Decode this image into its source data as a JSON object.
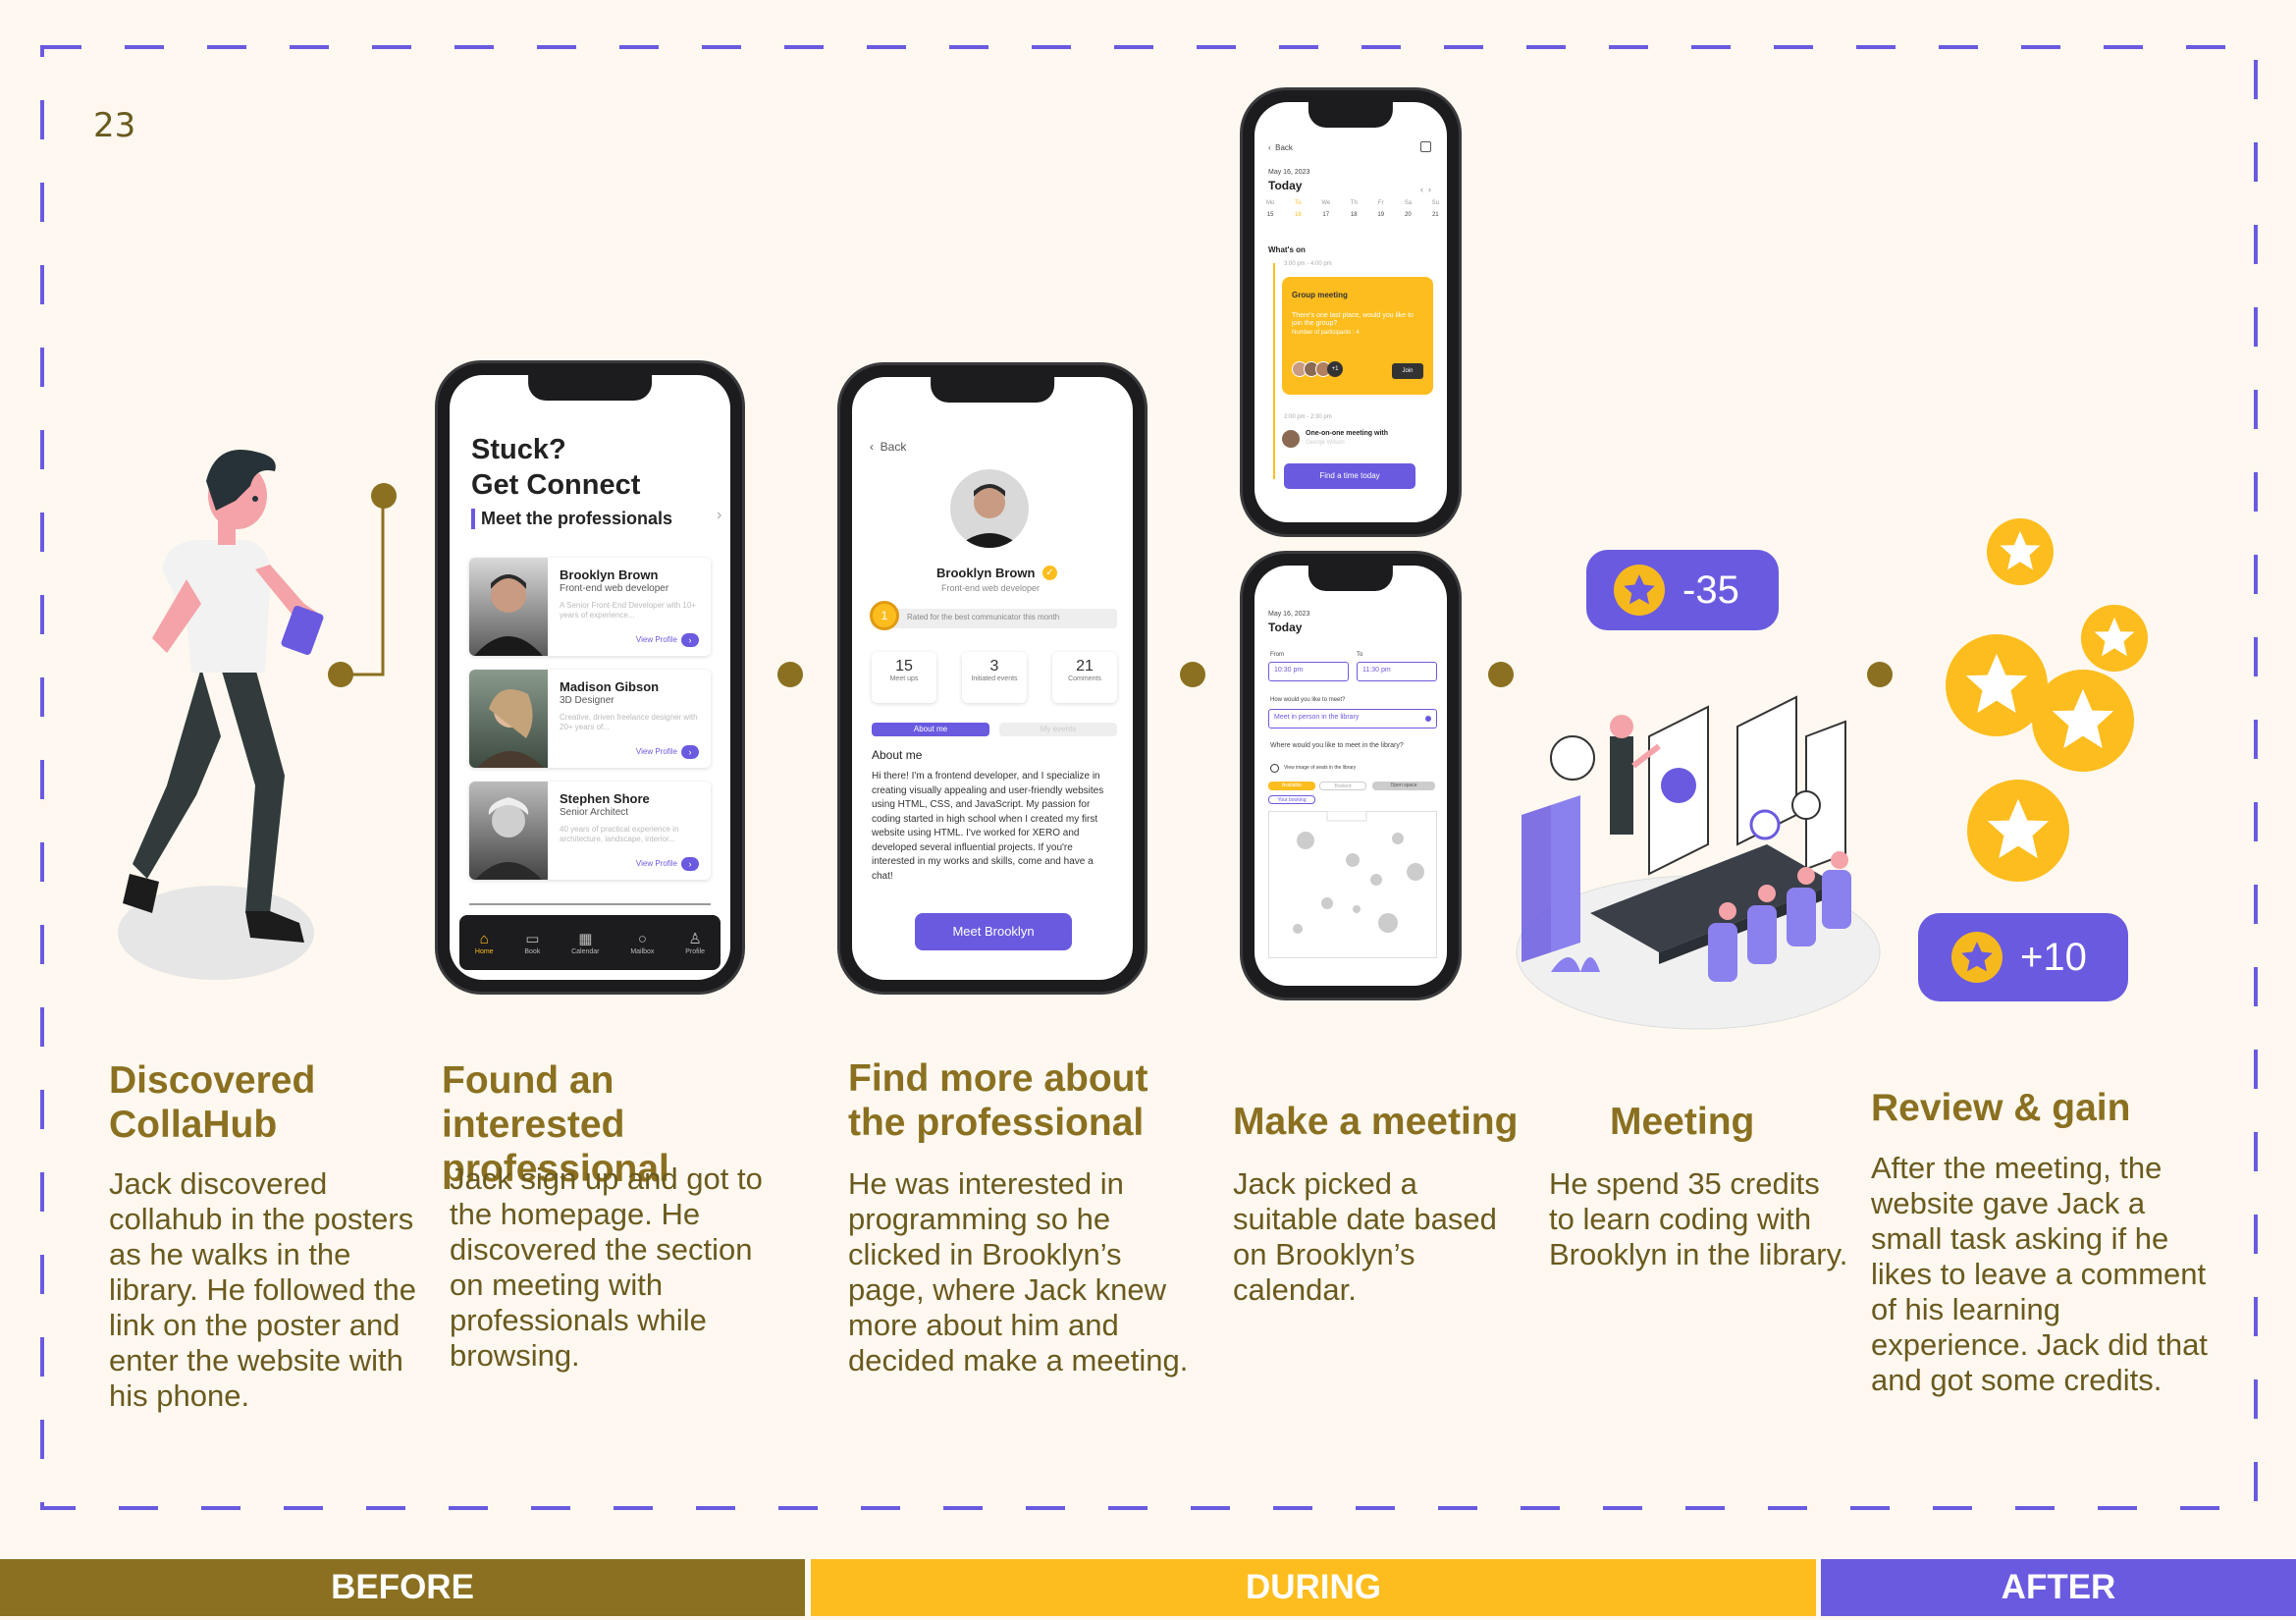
{
  "page_number": "23",
  "colors": {
    "accent": "#6a5ae0",
    "brand_gold": "#8a7020",
    "yellow": "#fdbd1e",
    "background": "#fef8f0"
  },
  "steps": [
    {
      "title": "Discovered CollaHub",
      "text": "Jack discovered collahub in the posters as he walks in the library. He followed the link on the poster and enter the website with his phone."
    },
    {
      "title": "Found an interested professional",
      "text": "Jack sign up and got to the homepage. He discovered the section on meeting with professionals while browsing."
    },
    {
      "title": "Find more about the professional",
      "text": "He was interested in programming so he clicked in Brooklyn’s page, where Jack knew more about him and decided make a meeting."
    },
    {
      "title": "Make a meeting",
      "text": "Jack picked a suitable date based on Brooklyn’s calendar."
    },
    {
      "title": "Meeting",
      "text": "He spend 35 credits to learn coding with Brooklyn in the library."
    },
    {
      "title": "Review & gain",
      "text": "After the meeting, the website gave Jack a small task asking if he likes to leave a comment of his learning experience. Jack did that and got some credits."
    }
  ],
  "bands": {
    "before": "BEFORE",
    "during": "DURING",
    "after": "AFTER"
  },
  "credits": {
    "spend": "-35",
    "gain": "+10"
  },
  "phone_home": {
    "heading_line1": "Stuck?",
    "heading_line2": "Get Connect",
    "section": "Meet the professionals",
    "view_profile": "View Profile",
    "cards": [
      {
        "name": "Brooklyn Brown",
        "role": "Front-end web developer",
        "desc": "A Senior Front-End Developer with 10+ years of experience..."
      },
      {
        "name": "Madison Gibson",
        "role": "3D Designer",
        "desc": "Creative, driven freelance designer with 20+ years of..."
      },
      {
        "name": "Stephen Shore",
        "role": "Senior Architect",
        "desc": "40 years of practical experience in architecture, landscape, interior..."
      }
    ],
    "nav": [
      "Home",
      "Book",
      "Calendar",
      "Mailbox",
      "Profile"
    ]
  },
  "phone_profile": {
    "back": "Back",
    "name": "Brooklyn Brown",
    "role": "Front-end web developer",
    "badge": "Rated for the best communicator this month",
    "stats": [
      {
        "value": "15",
        "label": "Meet ups"
      },
      {
        "value": "3",
        "label": "Initiated events"
      },
      {
        "value": "21",
        "label": "Comments"
      }
    ],
    "tab_about": "About me",
    "tab_events": "My events",
    "about_heading": "About me",
    "about_text": "Hi there! I'm a frontend developer, and I specialize in creating visually appealing and user-friendly websites using HTML, CSS, and JavaScript. My passion for coding started in high school when I created my first website using HTML. I've worked for XERO and developed several influential projects. If you're interested in my works and skills, come and have a chat!",
    "cta": "Meet Brooklyn"
  },
  "phone_calendar": {
    "back": "Back",
    "date": "May 16, 2023",
    "today": "Today",
    "days": [
      "Mo",
      "Tu",
      "We",
      "Th",
      "Fr",
      "Sa",
      "Su"
    ],
    "dates": [
      "15",
      "16",
      "17",
      "18",
      "19",
      "20",
      "21"
    ],
    "whats_on": "What's on",
    "time1": "3:00 pm - 4:00 pm",
    "group_title": "Group meeting",
    "group_text": "There's one last place, would you like to join the group?",
    "participants": "Number of participants : 4",
    "plus": "+1",
    "join": "Join",
    "time2": "2:00 pm - 2:30 pm",
    "one_on_one": "One-on-one meeting with",
    "with_name": "George Wilson",
    "cta": "Find a time today"
  },
  "phone_booking": {
    "date": "May 16, 2023",
    "today": "Today",
    "from_label": "From",
    "to_label": "To",
    "from_value": "10:30 pm",
    "to_value": "11:30 pm",
    "how_q": "How would you like to meet?",
    "how_a": "Meet in person in the library",
    "where_q": "Where would you like to meet in the library?",
    "view_seats": "View image of seats in the library",
    "chips": [
      "Available",
      "Booked",
      "Open space"
    ],
    "your_booking": "Your booking"
  }
}
